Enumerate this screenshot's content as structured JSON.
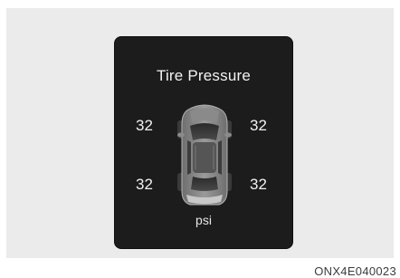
{
  "display": {
    "title": "Tire Pressure",
    "unit": "psi",
    "tires": {
      "front_left": "32",
      "front_right": "32",
      "rear_left": "32",
      "rear_right": "32"
    },
    "colors": {
      "panel_background": "#1c1c1c",
      "text": "#f2f2f2",
      "page_background": "#ebebeb"
    },
    "icon": "car-top-view-icon"
  },
  "figure_code": "ONX4E040023"
}
